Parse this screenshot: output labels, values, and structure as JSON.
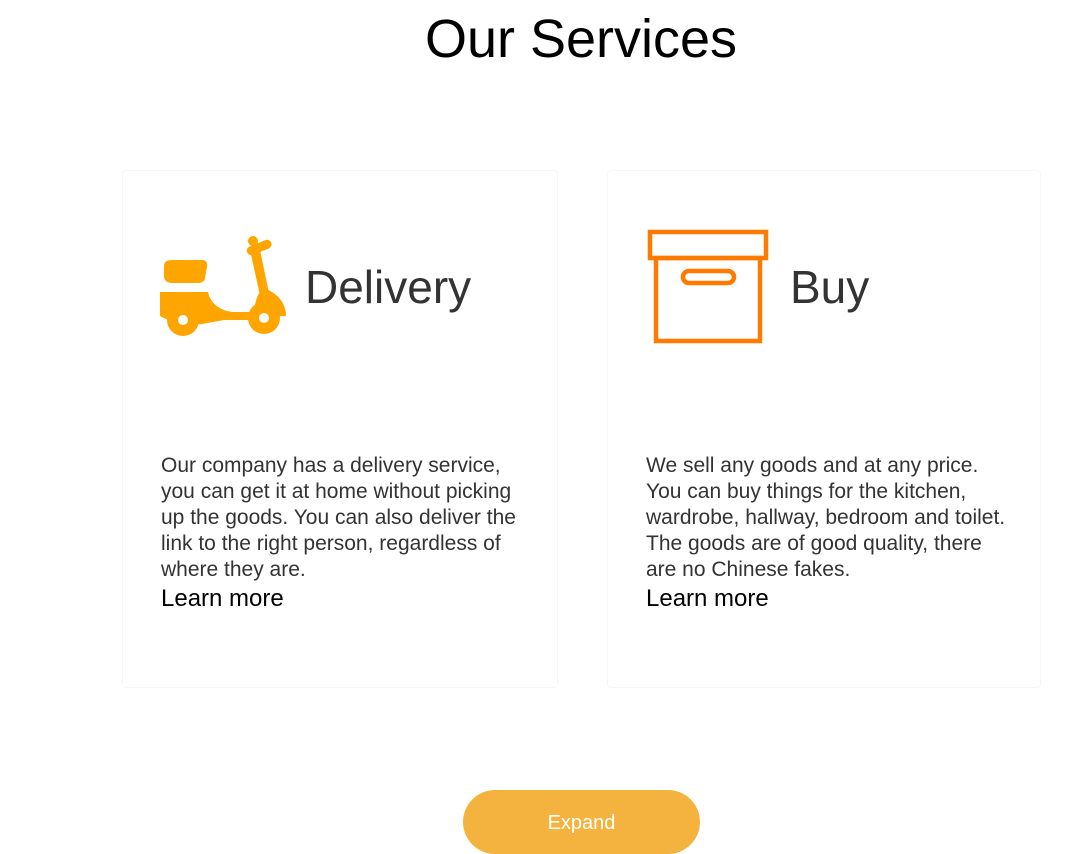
{
  "header": {
    "title": "Our Services"
  },
  "services": [
    {
      "icon": "scooter-icon",
      "title": "Delivery",
      "description": "Our company has a delivery service, you can get it at home without picking up the goods. You can also deliver the link to the right person, regardless of where they are.",
      "link_label": "Learn more"
    },
    {
      "icon": "box-icon",
      "title": "Buy",
      "description": "We sell any goods and at any price. You can buy things for the kitchen, wardrobe, hallway, bedroom and toilet. The goods are of good quality, there are no Chinese fakes.",
      "link_label": "Learn more"
    }
  ],
  "expand_button": {
    "label": "Expand"
  },
  "colors": {
    "scooter_icon": "#ffa500",
    "box_icon": "#ff7a00",
    "button": "#f4b33f",
    "heading_text": "#333333"
  }
}
